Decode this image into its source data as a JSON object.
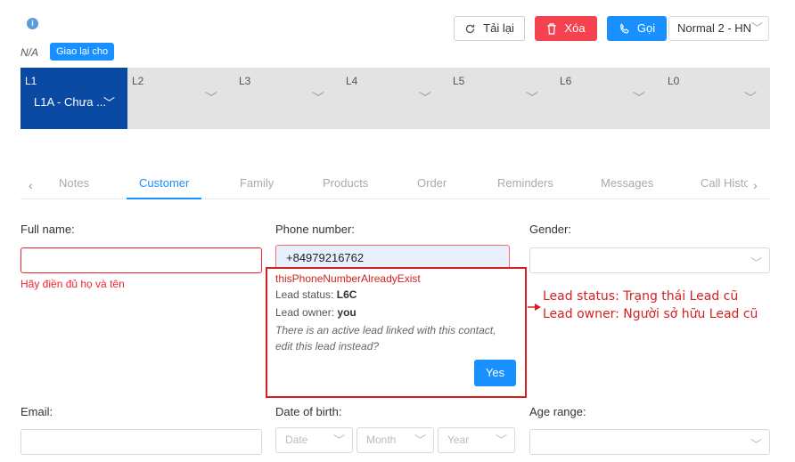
{
  "header": {
    "info_icon": "i",
    "na_text": "N/A",
    "assign_label": "Giao lại cho",
    "reload_label": "Tải lại",
    "delete_label": "Xóa",
    "call_label": "Gọi",
    "queue_select_value": "Normal 2 - HN"
  },
  "levels": [
    {
      "name": "L1",
      "value": "L1A - Chưa ..."
    },
    {
      "name": "L2"
    },
    {
      "name": "L3"
    },
    {
      "name": "L4"
    },
    {
      "name": "L5"
    },
    {
      "name": "L6"
    },
    {
      "name": "L0"
    }
  ],
  "tabs": [
    "Notes",
    "Customer",
    "Family",
    "Products",
    "Order",
    "Reminders",
    "Messages",
    "Call Histo"
  ],
  "active_tab": "Customer",
  "form": {
    "full_name_label": "Full name:",
    "full_name_error": "Hãy điền đủ họ và tên",
    "phone_label": "Phone number:",
    "phone_value": "+84979216762",
    "gender_label": "Gender:",
    "email_label": "Email:",
    "dob_label": "Date of birth:",
    "dob_date_placeholder": "Date",
    "dob_month_placeholder": "Month",
    "dob_year_placeholder": "Year",
    "age_range_label": "Age range:"
  },
  "popup": {
    "title": "thisPhoneNumberAlreadyExist",
    "lead_status_label": "Lead status:",
    "lead_status_value": "L6C",
    "lead_owner_label": "Lead owner:",
    "lead_owner_value": "you",
    "message": "There is an active lead linked with this contact, edit this lead instead?",
    "yes_label": "Yes"
  },
  "annotations": {
    "status_note": "Lead status: Trạng thái Lead cũ",
    "owner_note": "Lead owner: Người sở hữu Lead cũ"
  },
  "colors": {
    "primary": "#1890ff",
    "danger": "#f5424f",
    "active_level": "#0b4aa2",
    "annotation": "#d62020"
  }
}
